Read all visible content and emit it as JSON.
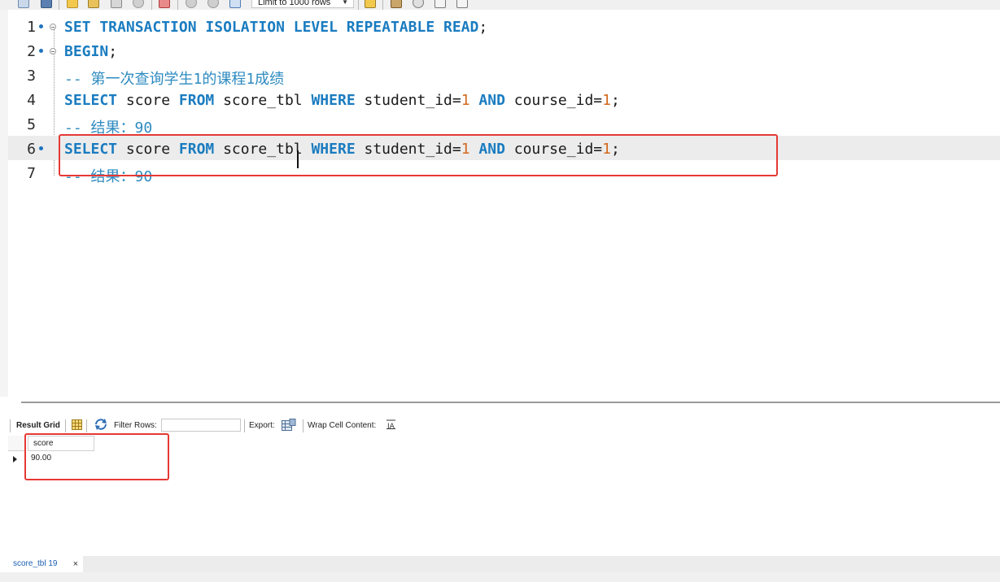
{
  "toolbar": {
    "limit_label": "Limit to 1000 rows",
    "icons": [
      "folder-icon",
      "save-icon",
      "execute-icon",
      "execute-current-icon",
      "explain-icon",
      "stop-icon",
      "toggle-stop-on-error-icon",
      "commit-icon",
      "rollback-icon",
      "autocommit-icon",
      "beautify-icon",
      "snippet-icon",
      "find-icon",
      "invisible-chars-icon",
      "word-wrap-icon"
    ]
  },
  "editor": {
    "lines": [
      {
        "no": "1",
        "dot": true,
        "fold": true,
        "tokens": [
          {
            "t": "SET TRANSACTION ISOLATION LEVEL REPEATABLE READ",
            "c": "kw"
          },
          {
            "t": ";",
            "c": ""
          }
        ]
      },
      {
        "no": "2",
        "dot": true,
        "fold": true,
        "tokens": [
          {
            "t": "BEGIN",
            "c": "kw"
          },
          {
            "t": ";",
            "c": ""
          }
        ]
      },
      {
        "no": "3",
        "dot": false,
        "fold": false,
        "tokens": [
          {
            "t": "-- 第一次查询学生1的课程1成绩",
            "c": "cmt"
          }
        ]
      },
      {
        "no": "4",
        "dot": false,
        "fold": false,
        "tokens": [
          {
            "t": "SELECT",
            "c": "kw"
          },
          {
            "t": " score ",
            "c": ""
          },
          {
            "t": "FROM",
            "c": "kw"
          },
          {
            "t": " score_tbl ",
            "c": ""
          },
          {
            "t": "WHERE",
            "c": "kw"
          },
          {
            "t": " student_id=",
            "c": ""
          },
          {
            "t": "1",
            "c": "num"
          },
          {
            "t": " ",
            "c": ""
          },
          {
            "t": "AND",
            "c": "kw"
          },
          {
            "t": " course_id=",
            "c": ""
          },
          {
            "t": "1",
            "c": "num"
          },
          {
            "t": ";",
            "c": ""
          }
        ]
      },
      {
        "no": "5",
        "dot": false,
        "fold": false,
        "tokens": [
          {
            "t": "-- 结果：90",
            "c": "cmt"
          }
        ]
      },
      {
        "no": "6",
        "dot": true,
        "fold": false,
        "current": true,
        "tokens": [
          {
            "t": "SELECT",
            "c": "kw"
          },
          {
            "t": " score ",
            "c": ""
          },
          {
            "t": "FROM",
            "c": "kw"
          },
          {
            "t": " score_tbl ",
            "c": ""
          },
          {
            "t": "WHERE",
            "c": "kw"
          },
          {
            "t": " student_id=",
            "c": ""
          },
          {
            "t": "1",
            "c": "num"
          },
          {
            "t": " ",
            "c": ""
          },
          {
            "t": "AND",
            "c": "kw"
          },
          {
            "t": " course_id=",
            "c": ""
          },
          {
            "t": "1",
            "c": "num"
          },
          {
            "t": ";",
            "c": ""
          }
        ]
      },
      {
        "no": "7",
        "dot": false,
        "fold": false,
        "tokens": [
          {
            "t": "-- 结果：90",
            "c": "cmt"
          }
        ]
      }
    ]
  },
  "result": {
    "result_grid_label": "Result Grid",
    "filter_label": "Filter Rows:",
    "filter_value": "",
    "export_label": "Export:",
    "wrap_label": "Wrap Cell Content:",
    "column_header": "score",
    "cell_value": "90.00"
  },
  "tabs": {
    "active_label": "score_tbl 19",
    "close_glyph": "×"
  },
  "colors": {
    "keyword": "#1a7cc0",
    "number": "#d2691e",
    "comment": "#2e8bc0",
    "highlight_box": "#e53935",
    "line_marker": "#1e73be"
  }
}
